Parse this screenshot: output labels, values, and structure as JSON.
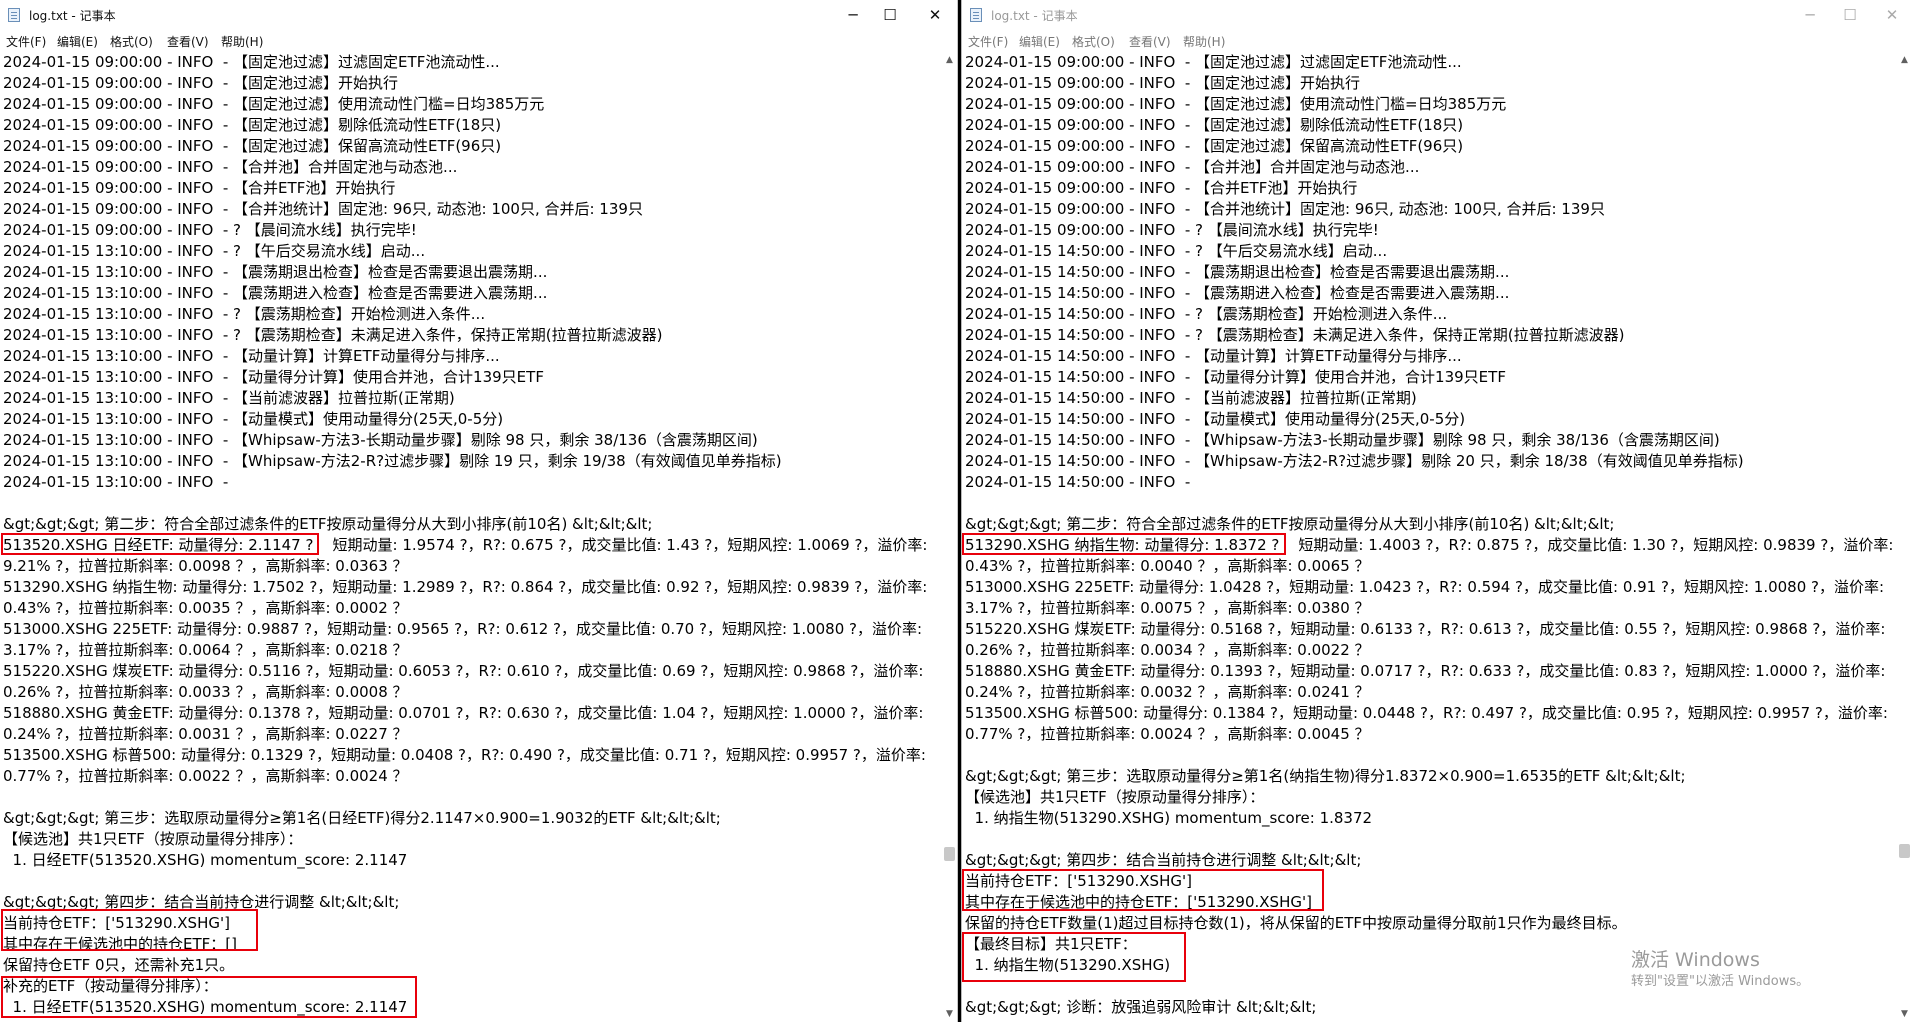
{
  "left": {
    "title": "log.txt - 记事本",
    "menu": [
      "文件(F)",
      "编辑(E)",
      "格式(O)",
      "查看(V)",
      "帮助(H)"
    ],
    "controls": {
      "minimize": "─",
      "maximize": "☐",
      "close": "✕"
    },
    "lines": [
      "2024-01-15 09:00:00 - INFO  - 【固定池过滤】过滤固定ETF池流动性...",
      "2024-01-15 09:00:00 - INFO  - 【固定池过滤】开始执行",
      "2024-01-15 09:00:00 - INFO  - 【固定池过滤】使用流动性门槛=日均385万元",
      "2024-01-15 09:00:00 - INFO  - 【固定池过滤】剔除低流动性ETF(18只)",
      "2024-01-15 09:00:00 - INFO  - 【固定池过滤】保留高流动性ETF(96只)",
      "2024-01-15 09:00:00 - INFO  - 【合并池】合并固定池与动态池...",
      "2024-01-15 09:00:00 - INFO  - 【合并ETF池】开始执行",
      "2024-01-15 09:00:00 - INFO  - 【合并池统计】固定池: 96只, 动态池: 100只, 合并后: 139只",
      "2024-01-15 09:00:00 - INFO  - ? 【晨间流水线】执行完毕!",
      "2024-01-15 13:10:00 - INFO  - ? 【午后交易流水线】启动...",
      "2024-01-15 13:10:00 - INFO  - 【震荡期退出检查】检查是否需要退出震荡期...",
      "2024-01-15 13:10:00 - INFO  - 【震荡期进入检查】检查是否需要进入震荡期...",
      "2024-01-15 13:10:00 - INFO  - ? 【震荡期检查】开始检测进入条件...",
      "2024-01-15 13:10:00 - INFO  - ? 【震荡期检查】未满足进入条件，保持正常期(拉普拉斯滤波器)",
      "2024-01-15 13:10:00 - INFO  - 【动量计算】计算ETF动量得分与排序...",
      "2024-01-15 13:10:00 - INFO  - 【动量得分计算】使用合并池，合计139只ETF",
      "2024-01-15 13:10:00 - INFO  - 【当前滤波器】拉普拉斯(正常期)",
      "2024-01-15 13:10:00 - INFO  - 【动量模式】使用动量得分(25天,0-5分)",
      "2024-01-15 13:10:00 - INFO  - 【Whipsaw-方法3-长期动量步骤】剔除 98 只，剩余 38/136（含震荡期区间)",
      "2024-01-15 13:10:00 - INFO  - 【Whipsaw-方法2-R?过滤步骤】剔除 19 只，剩余 19/38（有效阈值见单券指标)",
      "2024-01-15 13:10:00 - INFO  - ",
      "",
      "&gt;&gt;&gt; 第二步：符合全部过滤条件的ETF按原动量得分从大到小排序(前10名) &lt;&lt;&lt;",
      "513520.XSHG 日经ETF: 动量得分: 2.1147 ?    短期动量: 1.9574 ?，R?: 0.675 ?，成交量比值: 1.43 ?，短期风控: 1.0069 ?，溢价率:",
      "9.21% ?，拉普拉斯斜率: 0.0098 ？，高斯斜率: 0.0363 ？",
      "513290.XSHG 纳指生物: 动量得分: 1.7502 ?，短期动量: 1.2989 ?，R?: 0.864 ?，成交量比值: 0.92 ?，短期风控: 0.9839 ?，溢价率:",
      "0.43% ?，拉普拉斯斜率: 0.0035 ？，高斯斜率: 0.0002 ？",
      "513000.XSHG 225ETF: 动量得分: 0.9887 ?，短期动量: 0.9565 ?，R?: 0.612 ?，成交量比值: 0.70 ?，短期风控: 1.0080 ?，溢价率:",
      "3.17% ?，拉普拉斯斜率: 0.0064 ？，高斯斜率: 0.0218 ？",
      "515220.XSHG 煤炭ETF: 动量得分: 0.5116 ?，短期动量: 0.6053 ?，R?: 0.610 ?，成交量比值: 0.69 ?，短期风控: 0.9868 ?，溢价率:",
      "0.26% ?，拉普拉斯斜率: 0.0033 ？，高斯斜率: 0.0008 ？",
      "518880.XSHG 黄金ETF: 动量得分: 0.1378 ?，短期动量: 0.0701 ?，R?: 0.630 ?，成交量比值: 1.04 ?，短期风控: 1.0000 ?，溢价率:",
      "0.24% ?，拉普拉斯斜率: 0.0031 ？，高斯斜率: 0.0227 ？",
      "513500.XSHG 标普500: 动量得分: 0.1329 ?，短期动量: 0.0408 ?，R?: 0.490 ?，成交量比值: 0.71 ?，短期风控: 0.9957 ?，溢价率:",
      "0.77% ?，拉普拉斯斜率: 0.0022 ？，高斯斜率: 0.0024 ？",
      "",
      "&gt;&gt;&gt; 第三步：选取原动量得分≥第1名(日经ETF)得分2.1147×0.900=1.9032的ETF &lt;&lt;&lt;",
      "【候选池】共1只ETF（按原动量得分排序）：",
      "  1. 日经ETF(513520.XSHG) momentum_score: 2.1147",
      "",
      "&gt;&gt;&gt; 第四步：结合当前持仓进行调整 &lt;&lt;&lt;",
      "当前持仓ETF：['513290.XSHG']",
      "其中存在于候选池中的持仓ETF：[]",
      "保留持仓ETF 0只，还需补充1只。",
      "补充的ETF（按动量得分排序）：",
      "  1. 日经ETF(513520.XSHG) momentum_score: 2.1147"
    ]
  },
  "right": {
    "title": "log.txt - 记事本",
    "menu": [
      "文件(F)",
      "编辑(E)",
      "格式(O)",
      "查看(V)",
      "帮助(H)"
    ],
    "controls": {
      "minimize": "─",
      "maximize": "☐",
      "close": "✕"
    },
    "lines": [
      "2024-01-15 09:00:00 - INFO  - 【固定池过滤】过滤固定ETF池流动性...",
      "2024-01-15 09:00:00 - INFO  - 【固定池过滤】开始执行",
      "2024-01-15 09:00:00 - INFO  - 【固定池过滤】使用流动性门槛=日均385万元",
      "2024-01-15 09:00:00 - INFO  - 【固定池过滤】剔除低流动性ETF(18只)",
      "2024-01-15 09:00:00 - INFO  - 【固定池过滤】保留高流动性ETF(96只)",
      "2024-01-15 09:00:00 - INFO  - 【合并池】合并固定池与动态池...",
      "2024-01-15 09:00:00 - INFO  - 【合并ETF池】开始执行",
      "2024-01-15 09:00:00 - INFO  - 【合并池统计】固定池: 96只, 动态池: 100只, 合并后: 139只",
      "2024-01-15 09:00:00 - INFO  - ? 【晨间流水线】执行完毕!",
      "2024-01-15 14:50:00 - INFO  - ? 【午后交易流水线】启动...",
      "2024-01-15 14:50:00 - INFO  - 【震荡期退出检查】检查是否需要退出震荡期...",
      "2024-01-15 14:50:00 - INFO  - 【震荡期进入检查】检查是否需要进入震荡期...",
      "2024-01-15 14:50:00 - INFO  - ? 【震荡期检查】开始检测进入条件...",
      "2024-01-15 14:50:00 - INFO  - ? 【震荡期检查】未满足进入条件，保持正常期(拉普拉斯滤波器)",
      "2024-01-15 14:50:00 - INFO  - 【动量计算】计算ETF动量得分与排序...",
      "2024-01-15 14:50:00 - INFO  - 【动量得分计算】使用合并池，合计139只ETF",
      "2024-01-15 14:50:00 - INFO  - 【当前滤波器】拉普拉斯(正常期)",
      "2024-01-15 14:50:00 - INFO  - 【动量模式】使用动量得分(25天,0-5分)",
      "2024-01-15 14:50:00 - INFO  - 【Whipsaw-方法3-长期动量步骤】剔除 98 只，剩余 38/136（含震荡期区间)",
      "2024-01-15 14:50:00 - INFO  - 【Whipsaw-方法2-R?过滤步骤】剔除 20 只，剩余 18/38（有效阈值见单券指标)",
      "2024-01-15 14:50:00 - INFO  - ",
      "",
      "&gt;&gt;&gt; 第二步：符合全部过滤条件的ETF按原动量得分从大到小排序(前10名) &lt;&lt;&lt;",
      "513290.XSHG 纳指生物: 动量得分: 1.8372 ?    短期动量: 1.4003 ?，R?: 0.875 ?，成交量比值: 1.30 ?，短期风控: 0.9839 ?，溢价率:",
      "0.43% ?，拉普拉斯斜率: 0.0040 ？，高斯斜率: 0.0065 ？",
      "513000.XSHG 225ETF: 动量得分: 1.0428 ?，短期动量: 1.0423 ?，R?: 0.594 ?，成交量比值: 0.91 ?，短期风控: 1.0080 ?，溢价率:",
      "3.17% ?，拉普拉斯斜率: 0.0075 ？，高斯斜率: 0.0380 ？",
      "515220.XSHG 煤炭ETF: 动量得分: 0.5168 ?，短期动量: 0.6133 ?，R?: 0.613 ?，成交量比值: 0.55 ?，短期风控: 0.9868 ?，溢价率:",
      "0.26% ?，拉普拉斯斜率: 0.0034 ？，高斯斜率: 0.0022 ？",
      "518880.XSHG 黄金ETF: 动量得分: 0.1393 ?，短期动量: 0.0717 ?，R?: 0.633 ?，成交量比值: 0.83 ?，短期风控: 1.0000 ?，溢价率:",
      "0.24% ?，拉普拉斯斜率: 0.0032 ？，高斯斜率: 0.0241 ？",
      "513500.XSHG 标普500: 动量得分: 0.1384 ?，短期动量: 0.0448 ?，R?: 0.497 ?，成交量比值: 0.95 ?，短期风控: 0.9957 ?，溢价率:",
      "0.77% ?，拉普拉斯斜率: 0.0024 ？，高斯斜率: 0.0045 ？",
      "",
      "&gt;&gt;&gt; 第三步：选取原动量得分≥第1名(纳指生物)得分1.8372×0.900=1.6535的ETF &lt;&lt;&lt;",
      "【候选池】共1只ETF（按原动量得分排序）：",
      "  1. 纳指生物(513290.XSHG) momentum_score: 1.8372",
      "",
      "&gt;&gt;&gt; 第四步：结合当前持仓进行调整 &lt;&lt;&lt;",
      "当前持仓ETF：['513290.XSHG']",
      "其中存在于候选池中的持仓ETF：['513290.XSHG']",
      "保留的持仓ETF数量(1)超过目标持仓数(1)，将从保留的ETF中按原动量得分取前1只作为最终目标。",
      "【最终目标】共1只ETF：",
      "  1. 纳指生物(513290.XSHG)",
      "",
      "&gt;&gt;&gt; 诊断：放强追弱风险审计 &lt;&lt;&lt;"
    ]
  },
  "watermark": {
    "title": "激活 Windows",
    "subtitle": "转到\"设置\"以激活 Windows。"
  }
}
